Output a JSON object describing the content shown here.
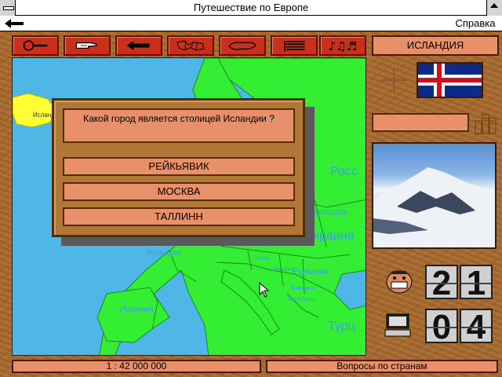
{
  "window": {
    "title": "Путешествие по Европе"
  },
  "menu": {
    "help": "Справка"
  },
  "toolbar": {
    "buttons": [
      {
        "icon": "magnifier-icon"
      },
      {
        "icon": "pointing-hand-icon"
      },
      {
        "icon": "back-arrow-icon"
      },
      {
        "icon": "regions-map-icon"
      },
      {
        "icon": "country-shape-icon"
      },
      {
        "icon": "flag-stripes-icon"
      },
      {
        "icon": "music-notes-icon"
      }
    ]
  },
  "country": {
    "name": "ИСЛАНДИЯ"
  },
  "map": {
    "labels": {
      "iceland": "Исланд",
      "russia": "Росс",
      "belarus": "еларусь",
      "ukraine": "краина",
      "france": "Франция",
      "spain": "Испания",
      "romania": "Румыния",
      "turkey": "Турц",
      "czech": "Чехия",
      "hungary": "Венгрия",
      "bulgaria": "Болгария",
      "gslavia": "Югославия"
    }
  },
  "quiz": {
    "question": "Какой город является столицей Исландии ?",
    "answers": [
      "РЕЙКЬЯВИК",
      "МОСКВА",
      "ТАЛЛИНН"
    ]
  },
  "score": {
    "correct": [
      "2",
      "1"
    ],
    "wrong": [
      "0",
      "4"
    ]
  },
  "status": {
    "scale": "1 : 42 000 000",
    "mode": "Вопросы по странам"
  },
  "colors": {
    "land": "#33ee33",
    "sea": "#4fb7e6",
    "iceland": "#ffff33",
    "panel": "#e8906a",
    "button_red": "#c8301c"
  }
}
